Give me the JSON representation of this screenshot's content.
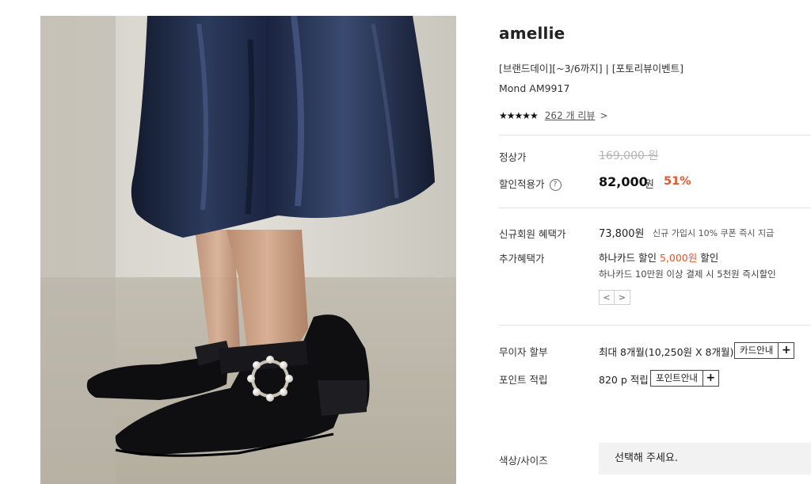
{
  "colors": {
    "accent": "#e0562e",
    "strike": "#b5b5b5",
    "divider": "#e2e2e2",
    "select_bg": "#f2f2f2"
  },
  "product": {
    "brand": "amellie",
    "promo": "[브랜드데이][~3/6까지] | [포토리뷰이벤트]",
    "model": "Mond AM9917",
    "stars_icon": "five-filled-stars",
    "stars": "★★★★★",
    "review_link": "262 개 리뷰",
    "review_chevron": ">"
  },
  "pricing": {
    "regular_label": "정상가",
    "regular_price": "169,000 원",
    "sale_label": "할인적용가",
    "help_icon": "?",
    "sale_price": "82,000",
    "sale_unit": "원",
    "discount": "51%"
  },
  "benefits": {
    "member_label": "신규회원 혜택가",
    "member_price": "73,800원",
    "member_note": "신규 가입시 10% 쿠폰 즉시 지급",
    "extra_label": "추가혜택가",
    "card_prefix": "하나카드 할인 ",
    "card_amount": "5,000원",
    "card_suffix": " 할인",
    "card_detail": "하나카드 10만원 이상 결제 시 5천원 즉시할인",
    "prev_icon": "<",
    "next_icon": ">"
  },
  "payment": {
    "installment_label": "무이자 할부",
    "installment_value": "최대 8개월(10,250원 X 8개월)",
    "card_guide": "카드안내",
    "point_label": "포인트 적립",
    "point_value": "820 p 적립",
    "point_guide": "포인트안내",
    "plus": "+"
  },
  "options": {
    "label": "색상/사이즈",
    "placeholder": "선택해 주세요."
  }
}
